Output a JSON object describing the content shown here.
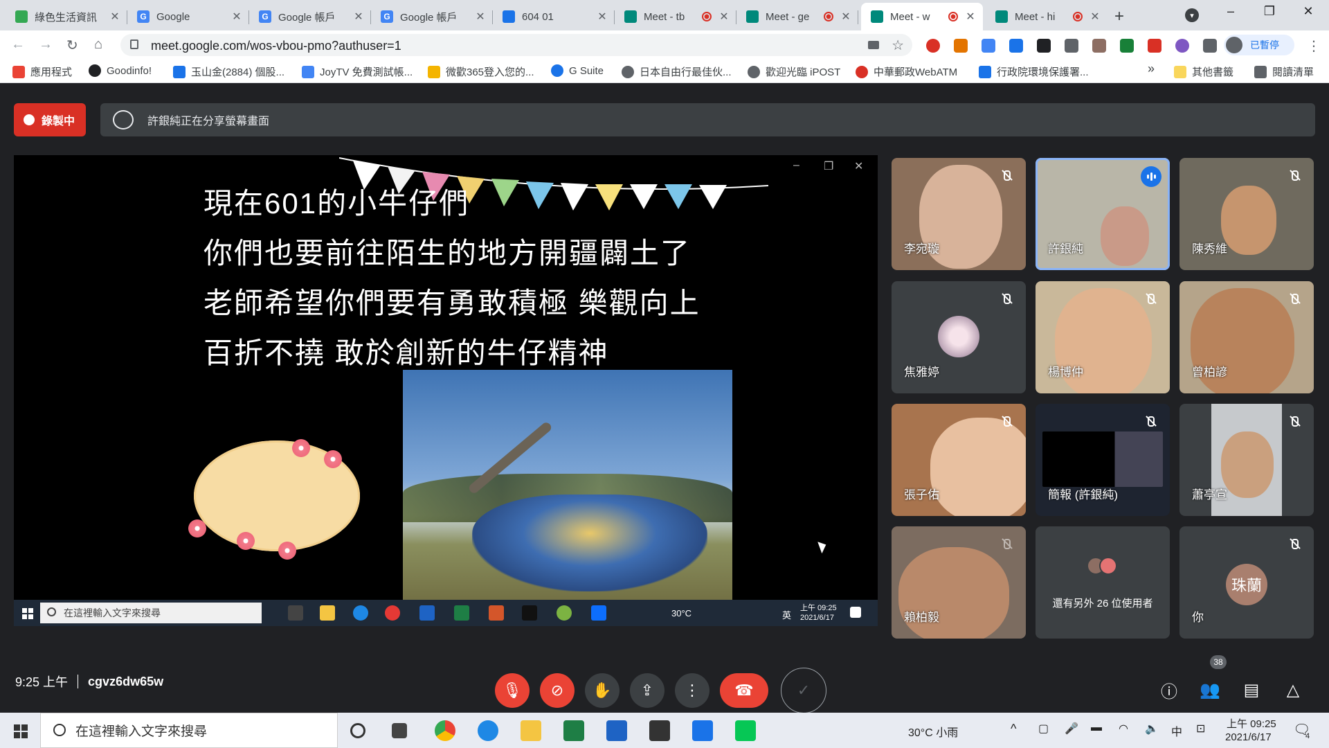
{
  "browser": {
    "tabs": [
      {
        "title": "綠色生活資訊",
        "color": "#34a853",
        "recording": false
      },
      {
        "title": "Google",
        "color": "#4285f4",
        "recording": false
      },
      {
        "title": "Google 帳戶",
        "color": "#4285f4",
        "recording": false
      },
      {
        "title": "Google 帳戶",
        "color": "#4285f4",
        "recording": false
      },
      {
        "title": "604 01",
        "color": "#1a73e8",
        "recording": false
      },
      {
        "title": "Meet - tb",
        "color": "#00897b",
        "recording": true
      },
      {
        "title": "Meet - ge",
        "color": "#00897b",
        "recording": true
      },
      {
        "title": "Meet - w",
        "color": "#00897b",
        "recording": true
      },
      {
        "title": "Meet - hi",
        "color": "#00897b",
        "recording": true
      }
    ],
    "active_tab_index": 7,
    "new_tab": "+",
    "url": "meet.google.com/wos-vbou-pmo?authuser=1",
    "profile_label": "已暫停"
  },
  "bookmarks": [
    {
      "label": "應用程式",
      "color": "#ea4335"
    },
    {
      "label": "Goodinfo!",
      "color": "#202124"
    },
    {
      "label": "玉山金(2884) 個股...",
      "color": "#1a73e8"
    },
    {
      "label": "JoyTV 免費測試帳...",
      "color": "#4285f4"
    },
    {
      "label": "微歡365登入您的...",
      "color": "#f4b400"
    },
    {
      "label": "G Suite",
      "color": "#1a73e8"
    },
    {
      "label": "日本自由行最佳伙...",
      "color": "#5f6368"
    },
    {
      "label": "歡迎光臨 iPOST",
      "color": "#5f6368"
    },
    {
      "label": "中華郵政WebATM",
      "color": "#d93025"
    },
    {
      "label": "行政院環境保護署...",
      "color": "#1a73e8"
    },
    {
      "label": "»",
      "color": ""
    },
    {
      "label": "其他書籤",
      "color": "#f9d65c"
    },
    {
      "label": "閱讀清單",
      "color": "#5f6368"
    }
  ],
  "meet": {
    "recording_label": "錄製中",
    "share_message": "許銀純正在分享螢幕畫面",
    "slide": {
      "lines": [
        "現在601的小牛仔們",
        "你們也要前往陌生的地方開疆闢土了",
        "老師希望你們要有勇敢積極  樂觀向上",
        "百折不撓   敢於創新的牛仔精神"
      ],
      "inner_taskbar": {
        "search_placeholder": "在這裡輸入文字來搜尋",
        "weather": "30°C",
        "ime": "英",
        "time": "上午 09:25",
        "date": "2021/6/17"
      }
    },
    "participants": [
      {
        "name": "李宛璇",
        "muted": true,
        "speaking": false,
        "bg": "#8b6f5a"
      },
      {
        "name": "許銀純",
        "muted": false,
        "speaking": true,
        "bg": "#b9b6a8"
      },
      {
        "name": "陳秀維",
        "muted": true,
        "speaking": false,
        "bg": "#6f6a5e"
      },
      {
        "name": "焦雅婷",
        "muted": true,
        "speaking": false,
        "bg": "#3c4043"
      },
      {
        "name": "楊博仲",
        "muted": true,
        "speaking": false,
        "bg": "#c9b89a"
      },
      {
        "name": "曾柏諺",
        "muted": true,
        "speaking": false,
        "bg": "#b5a48a"
      },
      {
        "name": "張子佑",
        "muted": true,
        "speaking": false,
        "bg": "#a8744e"
      },
      {
        "name": "簡報 (許銀純)",
        "muted": true,
        "speaking": false,
        "bg": "#1e2430"
      },
      {
        "name": "蕭亭宣",
        "muted": true,
        "speaking": false,
        "bg": "#c6c9cc"
      },
      {
        "name": "賴柏毅",
        "muted": true,
        "speaking": false,
        "bg": "#7c6c60"
      },
      {
        "name": "還有另外 26 位使用者",
        "muted": false,
        "speaking": false,
        "bg": "#3c4043"
      },
      {
        "name": "你",
        "muted": true,
        "speaking": false,
        "bg": "#3c4043",
        "initials": "珠蘭"
      }
    ],
    "time": "9:25 上午",
    "meeting_code": "cgvz6dw65w",
    "people_count": "38"
  },
  "windows_taskbar": {
    "search_placeholder": "在這裡輸入文字來搜尋",
    "weather": "30°C 小雨",
    "ime": "中",
    "time": "上午 09:25",
    "date": "2021/6/17",
    "notifications": "4"
  }
}
